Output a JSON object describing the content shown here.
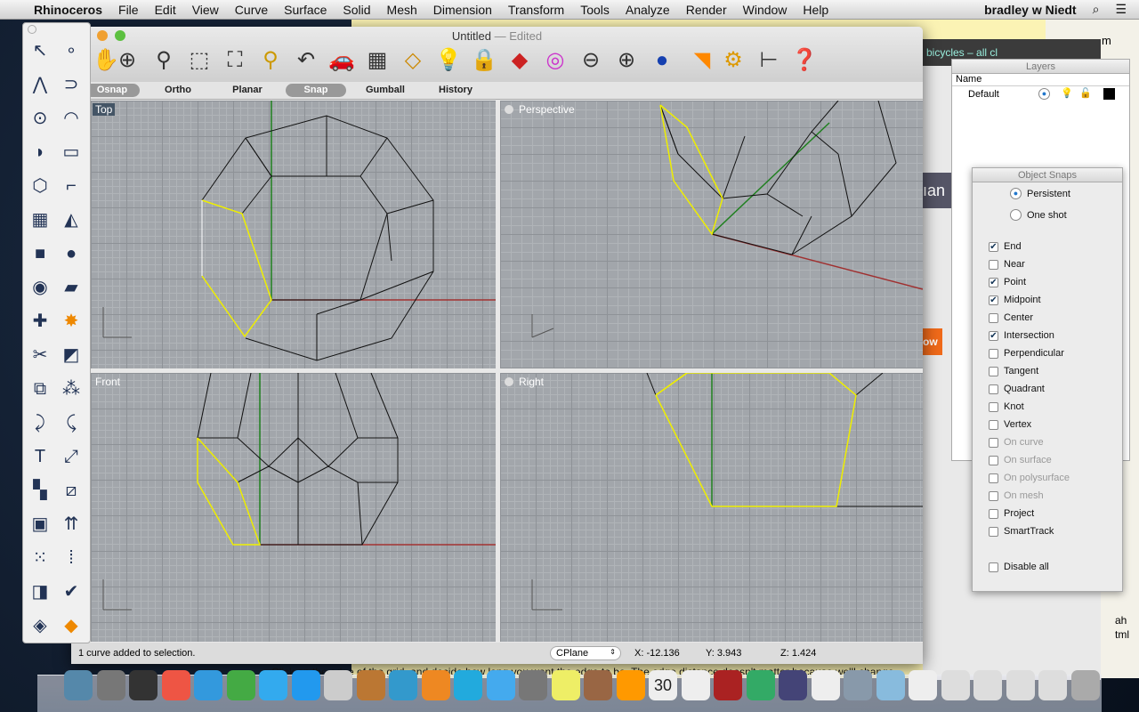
{
  "menubar": {
    "apple": "",
    "app": "Rhinoceros",
    "items": [
      "File",
      "Edit",
      "View",
      "Curve",
      "Surface",
      "Solid",
      "Mesh",
      "Dimension",
      "Transform",
      "Tools",
      "Analyze",
      "Render",
      "Window",
      "Help"
    ],
    "user": "bradley w Niedt"
  },
  "background": {
    "browser_tab": "bicycles – all cl",
    "frag_m": "m",
    "frag_ian": "ıan",
    "frag_ow": "ow",
    "frag_ah": "ah",
    "frag_tml": "tml"
  },
  "window": {
    "title": "Untitled",
    "edited": "— Edited",
    "toolbar": [
      "pan-hand",
      "rotate-view",
      "zoom-in-out",
      "zoom-window",
      "zoom-extents",
      "zoom-selected",
      "undo-view",
      "named-views-car",
      "cplane-grid",
      "object-snap-shapes",
      "lightbulb-show",
      "lock",
      "layer-color",
      "color-wheel",
      "sphere-wire",
      "sphere-grid",
      "render-sphere",
      "cone-light",
      "settings-gear",
      "dimension",
      "help"
    ],
    "toggles": [
      "Osnap",
      "Ortho",
      "Planar",
      "Snap",
      "Gumball",
      "History"
    ],
    "toggles_on": [
      "Osnap",
      "Snap"
    ],
    "viewports": [
      "Top",
      "Perspective",
      "Front",
      "Right"
    ],
    "status": {
      "message": "1 curve added to selection.",
      "cplane": "CPlane",
      "x": "X: -12.136",
      "y": "Y: 3.943",
      "z": "Z: 1.424"
    }
  },
  "palette": [
    "select-arrow",
    "point",
    "polyline",
    "curve",
    "circle",
    "rectangle-arc",
    "arc",
    "rectangle",
    "polygon",
    "fillet",
    "surface-grid",
    "surface-patch",
    "box",
    "sphere",
    "cylinder",
    "surface-plane",
    "boolean",
    "explode",
    "trim",
    "split",
    "join",
    "group",
    "curve-offset",
    "curve-fillet",
    "text",
    "scale",
    "array",
    "mirror",
    "extrude",
    "extrude-arrows",
    "grid-array",
    "align",
    "loft",
    "check",
    "solid-tools",
    "paint"
  ],
  "layers": {
    "title": "Layers",
    "header": "Name",
    "rows": [
      {
        "name": "Default",
        "color": "#000000"
      }
    ]
  },
  "osnap": {
    "title": "Object Snaps",
    "modes": [
      {
        "label": "Persistent",
        "selected": true
      },
      {
        "label": "One shot",
        "selected": false
      }
    ],
    "items": [
      {
        "label": "End",
        "checked": true,
        "enabled": true
      },
      {
        "label": "Near",
        "checked": false,
        "enabled": true
      },
      {
        "label": "Point",
        "checked": true,
        "enabled": true
      },
      {
        "label": "Midpoint",
        "checked": true,
        "enabled": true
      },
      {
        "label": "Center",
        "checked": false,
        "enabled": true
      },
      {
        "label": "Intersection",
        "checked": true,
        "enabled": true
      },
      {
        "label": "Perpendicular",
        "checked": false,
        "enabled": true
      },
      {
        "label": "Tangent",
        "checked": false,
        "enabled": true
      },
      {
        "label": "Quadrant",
        "checked": false,
        "enabled": true
      },
      {
        "label": "Knot",
        "checked": false,
        "enabled": true
      },
      {
        "label": "Vertex",
        "checked": false,
        "enabled": true
      },
      {
        "label": "On curve",
        "checked": false,
        "enabled": false
      },
      {
        "label": "On surface",
        "checked": false,
        "enabled": false
      },
      {
        "label": "On polysurface",
        "checked": false,
        "enabled": false
      },
      {
        "label": "On mesh",
        "checked": false,
        "enabled": false
      },
      {
        "label": "Project",
        "checked": false,
        "enabled": true
      },
      {
        "label": "SmartTrack",
        "checked": false,
        "enabled": true
      }
    ],
    "disable_all": "Disable all"
  },
  "hint": "Click on the edge of the grid, and decide how long you want the edge to be. The edge distance doesn't matter because we'll change",
  "dock": {
    "calendar_day": "30",
    "apps": [
      "finder",
      "launchpad",
      "dashboard",
      "compass-app",
      "itunes",
      "chrome",
      "safari",
      "app-store",
      "rhino",
      "paint-app",
      "word",
      "pages",
      "skype",
      "messages",
      "system-preferences",
      "stickies",
      "iphoto",
      "garageband",
      "calendar",
      "reminders",
      "photo-booth",
      "time-machine",
      "preview",
      "image-capture",
      "photos",
      "downloads-folder",
      "document",
      "document",
      "document",
      "document",
      "document",
      "trash"
    ]
  },
  "colors": {
    "selected_curve": "#ffff00",
    "x_axis": "#a03030",
    "y_axis": "#208020",
    "viewport_bg": "#a2a6ab",
    "accent": "#2a7ad8"
  }
}
